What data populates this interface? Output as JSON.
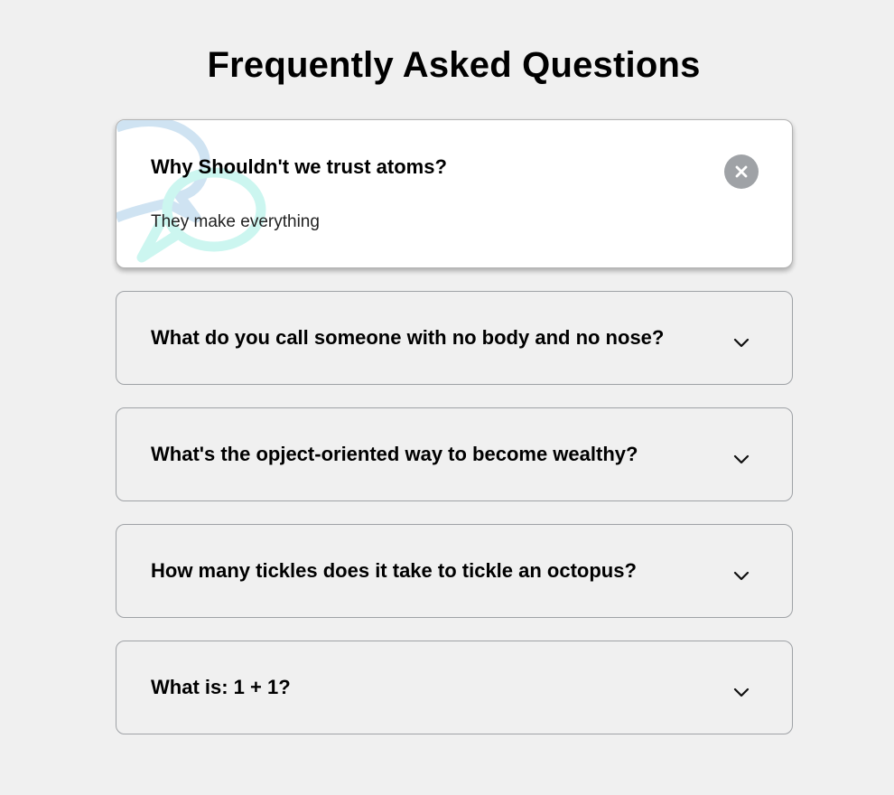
{
  "page": {
    "title": "Frequently Asked Questions"
  },
  "faqs": [
    {
      "question": "Why Shouldn't we trust atoms?",
      "answer": "They make everything",
      "expanded": true,
      "toggle_icon": "close-icon"
    },
    {
      "question": "What do you call someone with no body and no nose?",
      "expanded": false,
      "toggle_icon": "chevron-down-icon"
    },
    {
      "question": "What's the opject-oriented way to become wealthy?",
      "expanded": false,
      "toggle_icon": "chevron-down-icon"
    },
    {
      "question": "How many tickles does it take to tickle an octopus?",
      "expanded": false,
      "toggle_icon": "chevron-down-icon"
    },
    {
      "question": "What is: 1 + 1?",
      "expanded": false,
      "toggle_icon": "chevron-down-icon"
    }
  ],
  "colors": {
    "background": "#f0f0f0",
    "card_active": "#ffffff",
    "border": "#9fa2a6",
    "close_button": "#9fa2a6",
    "deco_bubble_back": "#cfe3f2",
    "deco_bubble_front": "#ccf6f0"
  }
}
